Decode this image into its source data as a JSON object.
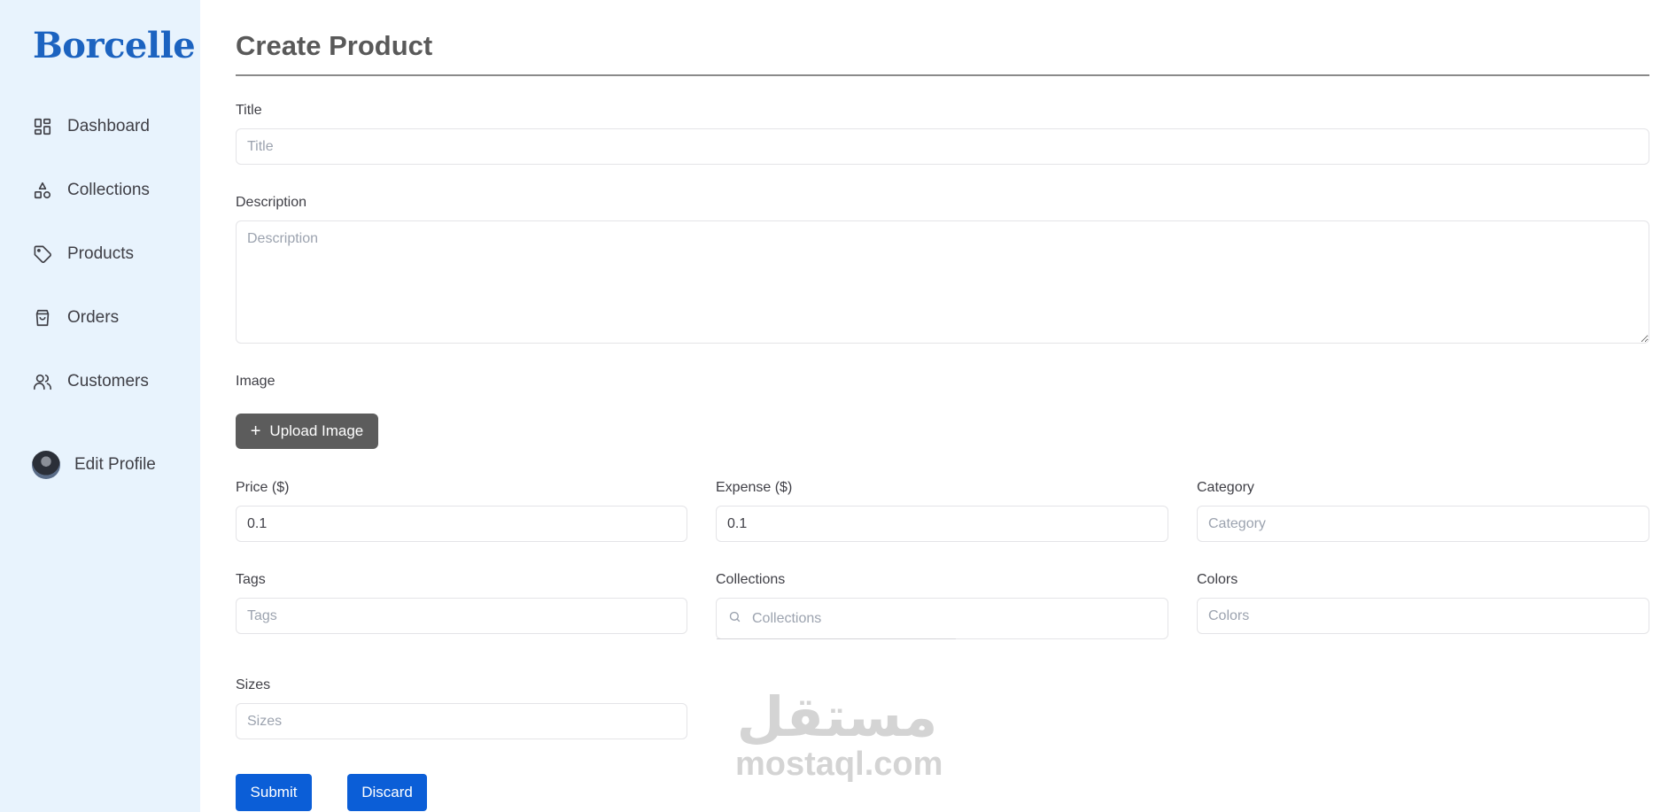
{
  "sidebar": {
    "logo": "Borcelle",
    "items": [
      {
        "label": "Dashboard",
        "icon": "dashboard-icon"
      },
      {
        "label": "Collections",
        "icon": "shapes-icon"
      },
      {
        "label": "Products",
        "icon": "tag-icon"
      },
      {
        "label": "Orders",
        "icon": "shopping-bag-icon"
      },
      {
        "label": "Customers",
        "icon": "users-icon"
      }
    ],
    "profile": {
      "label": "Edit Profile"
    }
  },
  "main": {
    "title": "Create Product",
    "title_field": {
      "label": "Title",
      "placeholder": "Title",
      "value": ""
    },
    "description_field": {
      "label": "Description",
      "placeholder": "Description",
      "value": ""
    },
    "image": {
      "label": "Image",
      "upload_label": "Upload Image"
    },
    "price": {
      "label": "Price ($)",
      "value": "0.1"
    },
    "expense": {
      "label": "Expense ($)",
      "value": "0.1"
    },
    "category": {
      "label": "Category",
      "placeholder": "Category",
      "value": ""
    },
    "tags": {
      "label": "Tags",
      "placeholder": "Tags",
      "value": ""
    },
    "collections": {
      "label": "Collections",
      "placeholder": "Collections",
      "value": ""
    },
    "colors": {
      "label": "Colors",
      "placeholder": "Colors",
      "value": ""
    },
    "sizes": {
      "label": "Sizes",
      "placeholder": "Sizes",
      "value": ""
    },
    "submit_label": "Submit",
    "discard_label": "Discard"
  },
  "watermark": {
    "arabic": "مستقل",
    "text": "mostaql.com"
  },
  "colors": {
    "sidebar_bg": "#e8f3fd",
    "brand": "#1c63c0",
    "primary_button": "#0b5ed7",
    "upload_button": "#5c5c5c"
  }
}
